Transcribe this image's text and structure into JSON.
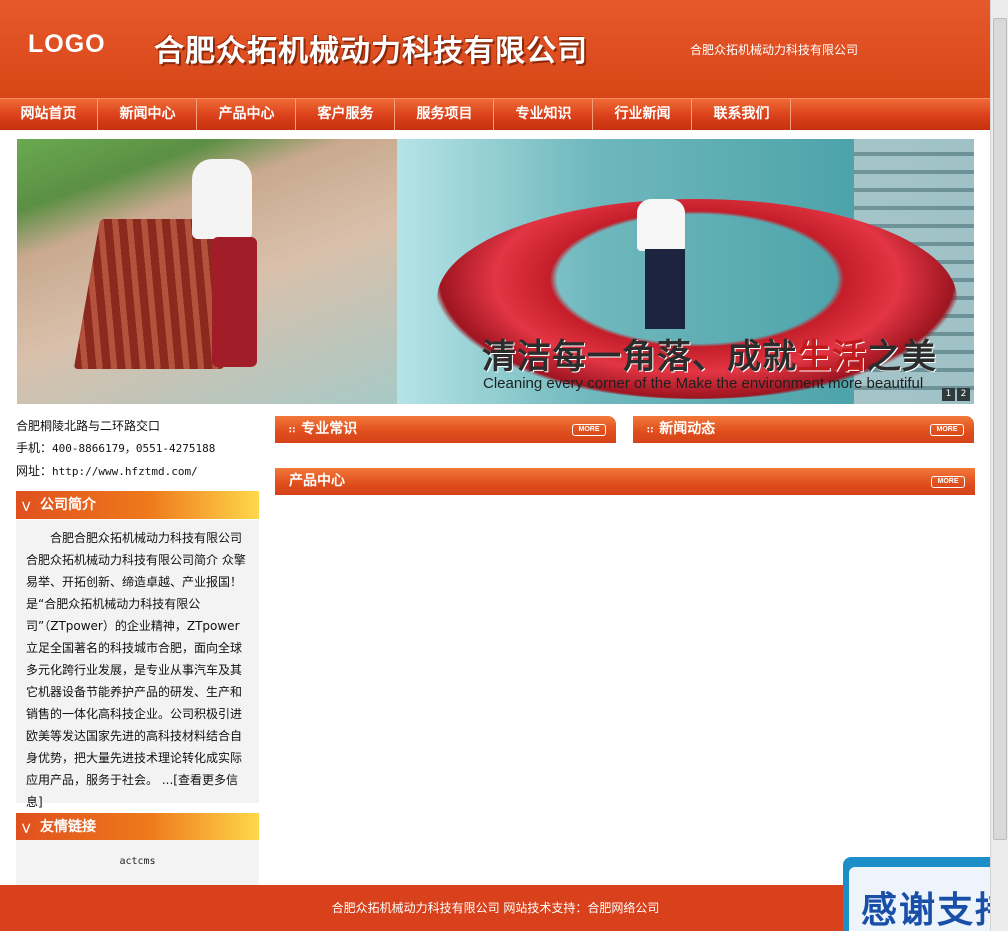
{
  "header": {
    "logo": "LOGO",
    "site_title": "合肥众拓机械动力科技有限公司",
    "right_text": "合肥众拓机械动力科技有限公司"
  },
  "nav": [
    "网站首页",
    "新闻中心",
    "产品中心",
    "客户服务",
    "服务项目",
    "专业知识",
    "行业新闻",
    "联系我们"
  ],
  "banner": {
    "slogan_cn_part1": "清洁每一角落、成就",
    "slogan_cn_red": "生活",
    "slogan_cn_part2": "之美",
    "slogan_en": "Cleaning every corner of the Make the environment more beautiful",
    "pages": [
      "1",
      "2"
    ]
  },
  "contact": {
    "address": "合肥桐陵北路与二环路交口",
    "phone_label": "手机：",
    "phone_value": "400-8866179，0551-4275188",
    "web_label": "网址：",
    "web_value": "http://www.hfztmd.com/"
  },
  "company_intro": {
    "title": "公司简介",
    "text": "合肥合肥众拓机械动力科技有限公司合肥众拓机械动力科技有限公司简介 众擎易举、开拓创新、缔造卓越、产业报国！是“合肥众拓机械动力科技有限公司”（ZTpower）的企业精神，ZTpower立足全国著名的科技城市合肥，面向全球多元化跨行业发展，是专业从事汽车及其它机器设备节能养护产品的研发、生产和销售的一体化高科技企业。公司积极引进欧美等发达国家先进的高科技材料结合自身优势，把大量先进技术理论转化成实际应用产品，服务于社会。",
    "more": "...[查看更多信息]"
  },
  "friend_links": {
    "title": "友情链接",
    "items": [
      "actcms"
    ]
  },
  "sections": {
    "knowledge": "专业常识",
    "news": "新闻动态",
    "products": "产品中心",
    "more_label": "MORE"
  },
  "footer": {
    "text": "合肥众拓机械动力科技有限公司 网站技术支持：合肥网络公司"
  },
  "float_ad": {
    "text": "感谢支持"
  },
  "colors": {
    "brand_orange": "#de4d1f",
    "footer": "#d8411b",
    "slogan_red": "#c21a1a"
  }
}
